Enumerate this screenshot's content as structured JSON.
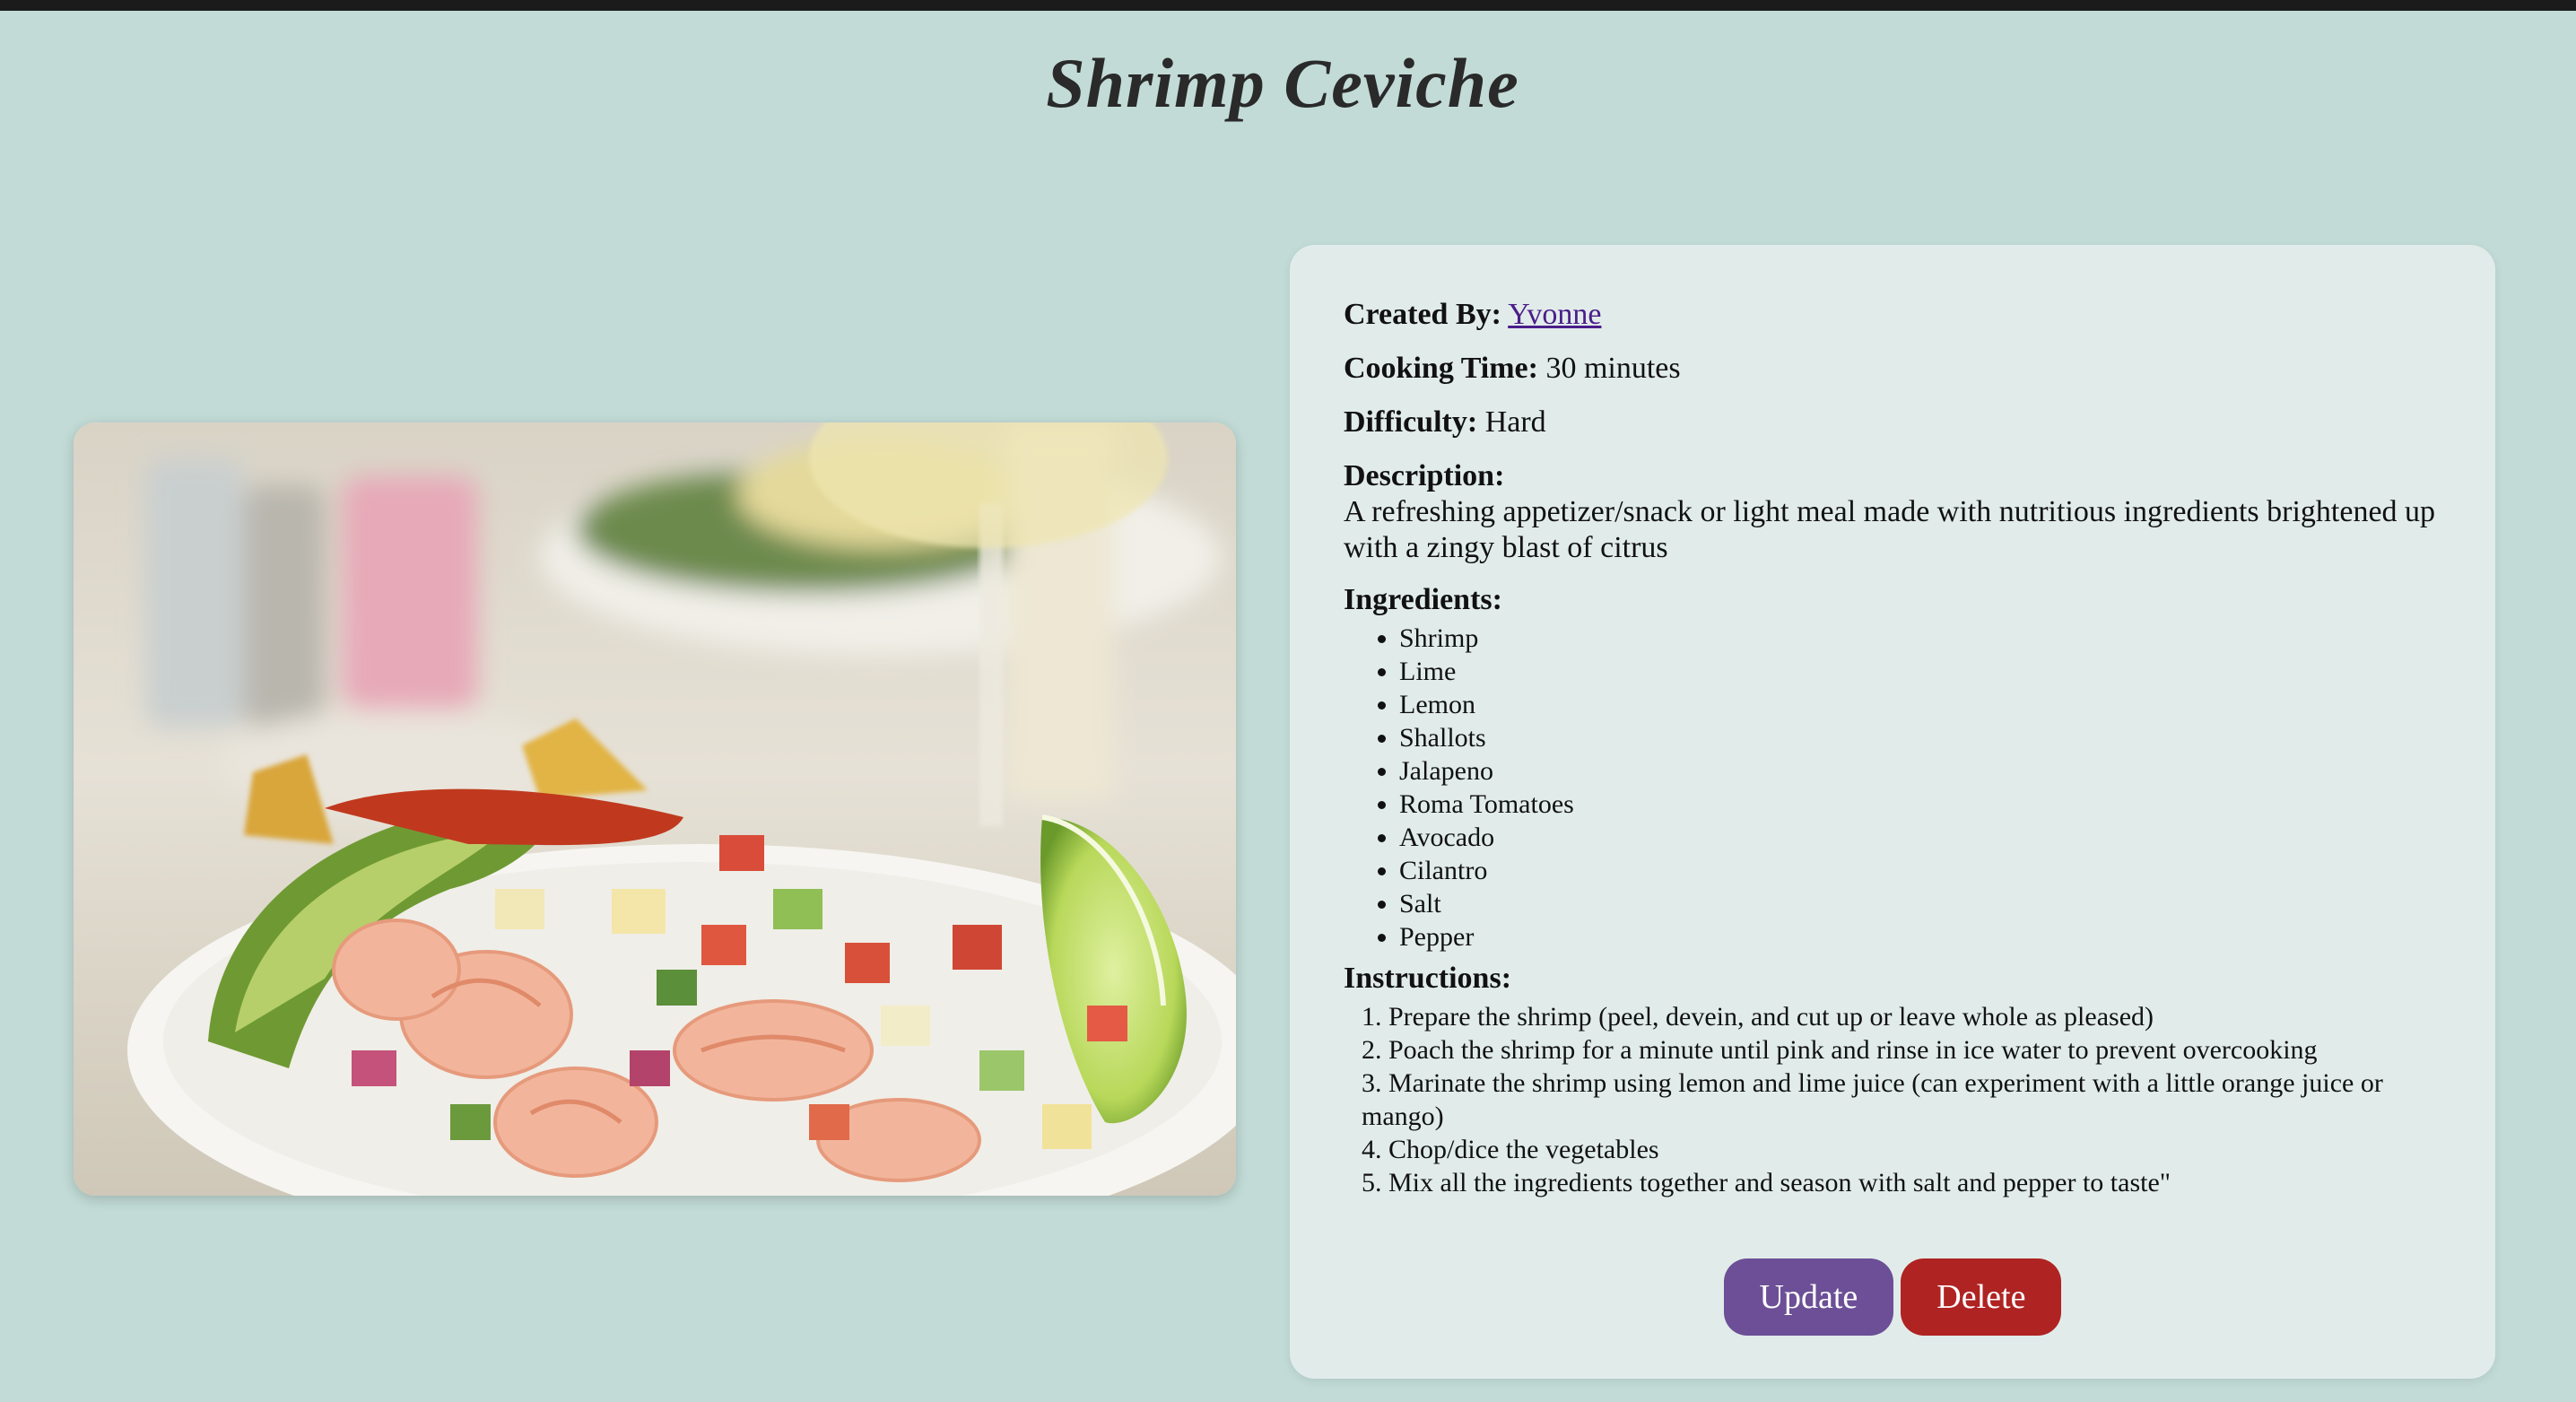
{
  "page": {
    "title": "Shrimp Ceviche"
  },
  "recipe": {
    "created_by_label": "Created By:",
    "created_by": "Yvonne",
    "cooking_time_label": "Cooking Time:",
    "cooking_time": "30 minutes",
    "difficulty_label": "Difficulty:",
    "difficulty": "Hard",
    "description_label": "Description:",
    "description": "A refreshing appetizer/snack or light meal made with nutritious ingredients brightened up with a zingy blast of citrus",
    "ingredients_label": "Ingredients:",
    "ingredients": [
      "Shrimp",
      "Lime",
      "Lemon",
      "Shallots",
      "Jalapeno",
      "Roma Tomatoes",
      "Avocado",
      "Cilantro",
      "Salt",
      "Pepper"
    ],
    "instructions_label": "Instructions:",
    "instructions": [
      "1. Prepare the shrimp (peel, devein, and cut up or leave whole as pleased)",
      "2. Poach the shrimp for a minute until pink and rinse in ice water to prevent overcooking",
      "3. Marinate the shrimp using lemon and lime juice (can experiment with a little orange juice or mango)",
      "4. Chop/dice the vegetables",
      "5. Mix all the ingredients together and season with salt and pepper to taste\""
    ]
  },
  "actions": {
    "update_label": "Update",
    "delete_label": "Delete"
  },
  "colors": {
    "background": "#c2dbd6",
    "card": "#e1ecea",
    "update": "#6c4f96",
    "delete": "#b02323",
    "link": "#4b1d8a"
  }
}
